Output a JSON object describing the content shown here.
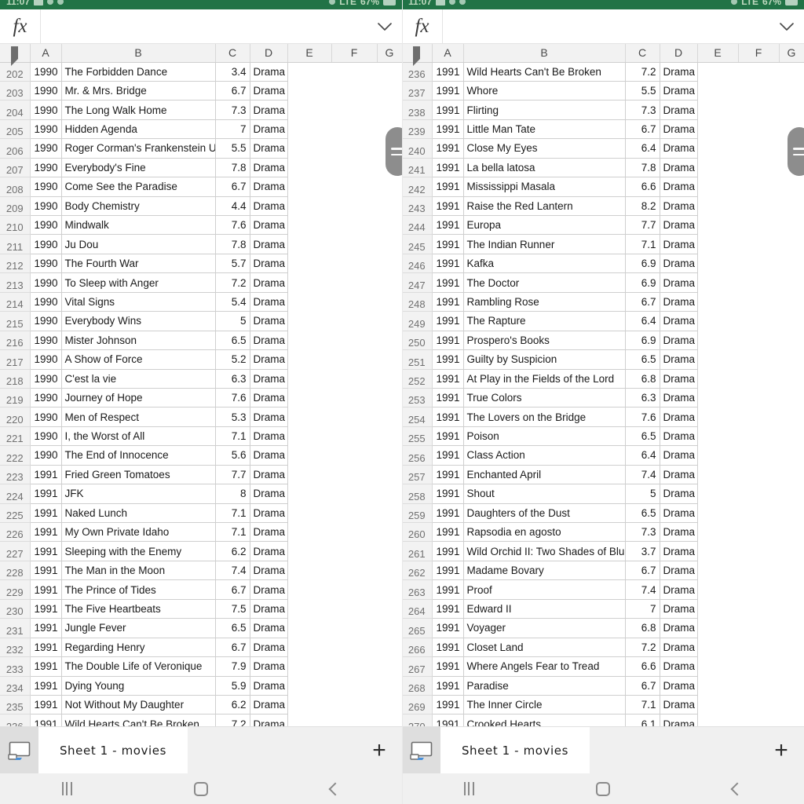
{
  "app": {
    "accent_color": "#217346",
    "status_bar": {
      "time": "11:07",
      "battery": "67%",
      "network": "LTE"
    }
  },
  "formula_bar": {
    "fx_label": "fx",
    "value": "",
    "placeholder": "",
    "chevron": "⌄"
  },
  "columns": {
    "headers": [
      "A",
      "B",
      "C",
      "D",
      "E",
      "F",
      "G"
    ],
    "corner": "select-all"
  },
  "sheet_tab": {
    "label": "Sheet 1 - movies",
    "add_label": "+"
  },
  "nav": {
    "recent": "recents",
    "home": "home",
    "back": "back"
  },
  "panes": [
    {
      "id": "left",
      "rows": [
        {
          "n": "202",
          "year": "1990",
          "title": "The Forbidden Dance",
          "score": "3.4",
          "genre": "Drama"
        },
        {
          "n": "203",
          "year": "1990",
          "title": "Mr. & Mrs. Bridge",
          "score": "6.7",
          "genre": "Drama"
        },
        {
          "n": "204",
          "year": "1990",
          "title": "The Long Walk Home",
          "score": "7.3",
          "genre": "Drama"
        },
        {
          "n": "205",
          "year": "1990",
          "title": "Hidden Agenda",
          "score": "7",
          "genre": "Drama"
        },
        {
          "n": "206",
          "year": "1990",
          "title": "Roger Corman's Frankenstein Unbound",
          "score": "5.5",
          "genre": "Drama"
        },
        {
          "n": "207",
          "year": "1990",
          "title": "Everybody's Fine",
          "score": "7.8",
          "genre": "Drama"
        },
        {
          "n": "208",
          "year": "1990",
          "title": "Come See the Paradise",
          "score": "6.7",
          "genre": "Drama"
        },
        {
          "n": "209",
          "year": "1990",
          "title": "Body Chemistry",
          "score": "4.4",
          "genre": "Drama"
        },
        {
          "n": "210",
          "year": "1990",
          "title": "Mindwalk",
          "score": "7.6",
          "genre": "Drama"
        },
        {
          "n": "211",
          "year": "1990",
          "title": "Ju Dou",
          "score": "7.8",
          "genre": "Drama"
        },
        {
          "n": "212",
          "year": "1990",
          "title": "The Fourth War",
          "score": "5.7",
          "genre": "Drama"
        },
        {
          "n": "213",
          "year": "1990",
          "title": "To Sleep with Anger",
          "score": "7.2",
          "genre": "Drama"
        },
        {
          "n": "214",
          "year": "1990",
          "title": "Vital Signs",
          "score": "5.4",
          "genre": "Drama"
        },
        {
          "n": "215",
          "year": "1990",
          "title": "Everybody Wins",
          "score": "5",
          "genre": "Drama"
        },
        {
          "n": "216",
          "year": "1990",
          "title": "Mister Johnson",
          "score": "6.5",
          "genre": "Drama"
        },
        {
          "n": "217",
          "year": "1990",
          "title": "A Show of Force",
          "score": "5.2",
          "genre": "Drama"
        },
        {
          "n": "218",
          "year": "1990",
          "title": "C'est la vie",
          "score": "6.3",
          "genre": "Drama"
        },
        {
          "n": "219",
          "year": "1990",
          "title": "Journey of Hope",
          "score": "7.6",
          "genre": "Drama"
        },
        {
          "n": "220",
          "year": "1990",
          "title": "Men of Respect",
          "score": "5.3",
          "genre": "Drama"
        },
        {
          "n": "221",
          "year": "1990",
          "title": "I, the Worst of All",
          "score": "7.1",
          "genre": "Drama"
        },
        {
          "n": "222",
          "year": "1990",
          "title": "The End of Innocence",
          "score": "5.6",
          "genre": "Drama"
        },
        {
          "n": "223",
          "year": "1991",
          "title": "Fried Green Tomatoes",
          "score": "7.7",
          "genre": "Drama"
        },
        {
          "n": "224",
          "year": "1991",
          "title": "JFK",
          "score": "8",
          "genre": "Drama"
        },
        {
          "n": "225",
          "year": "1991",
          "title": "Naked Lunch",
          "score": "7.1",
          "genre": "Drama"
        },
        {
          "n": "226",
          "year": "1991",
          "title": "My Own Private Idaho",
          "score": "7.1",
          "genre": "Drama"
        },
        {
          "n": "227",
          "year": "1991",
          "title": "Sleeping with the Enemy",
          "score": "6.2",
          "genre": "Drama"
        },
        {
          "n": "228",
          "year": "1991",
          "title": "The Man in the Moon",
          "score": "7.4",
          "genre": "Drama"
        },
        {
          "n": "229",
          "year": "1991",
          "title": "The Prince of Tides",
          "score": "6.7",
          "genre": "Drama"
        },
        {
          "n": "230",
          "year": "1991",
          "title": "The Five Heartbeats",
          "score": "7.5",
          "genre": "Drama"
        },
        {
          "n": "231",
          "year": "1991",
          "title": "Jungle Fever",
          "score": "6.5",
          "genre": "Drama"
        },
        {
          "n": "232",
          "year": "1991",
          "title": "Regarding Henry",
          "score": "6.7",
          "genre": "Drama"
        },
        {
          "n": "233",
          "year": "1991",
          "title": "The Double Life of Veronique",
          "score": "7.9",
          "genre": "Drama"
        },
        {
          "n": "234",
          "year": "1991",
          "title": "Dying Young",
          "score": "5.9",
          "genre": "Drama"
        },
        {
          "n": "235",
          "year": "1991",
          "title": "Not Without My Daughter",
          "score": "6.2",
          "genre": "Drama"
        },
        {
          "n": "236",
          "year": "1991",
          "title": "Wild Hearts Can't Be Broken",
          "score": "7.2",
          "genre": "Drama"
        }
      ]
    },
    {
      "id": "right",
      "rows": [
        {
          "n": "236",
          "year": "1991",
          "title": "Wild Hearts Can't Be Broken",
          "score": "7.2",
          "genre": "Drama"
        },
        {
          "n": "237",
          "year": "1991",
          "title": "Whore",
          "score": "5.5",
          "genre": "Drama"
        },
        {
          "n": "238",
          "year": "1991",
          "title": "Flirting",
          "score": "7.3",
          "genre": "Drama"
        },
        {
          "n": "239",
          "year": "1991",
          "title": "Little Man Tate",
          "score": "6.7",
          "genre": "Drama"
        },
        {
          "n": "240",
          "year": "1991",
          "title": "Close My Eyes",
          "score": "6.4",
          "genre": "Drama"
        },
        {
          "n": "241",
          "year": "1991",
          "title": "La bella latosa",
          "score": "7.8",
          "genre": "Drama"
        },
        {
          "n": "242",
          "year": "1991",
          "title": "Mississippi Masala",
          "score": "6.6",
          "genre": "Drama"
        },
        {
          "n": "243",
          "year": "1991",
          "title": "Raise the Red Lantern",
          "score": "8.2",
          "genre": "Drama"
        },
        {
          "n": "244",
          "year": "1991",
          "title": "Europa",
          "score": "7.7",
          "genre": "Drama"
        },
        {
          "n": "245",
          "year": "1991",
          "title": "The Indian Runner",
          "score": "7.1",
          "genre": "Drama"
        },
        {
          "n": "246",
          "year": "1991",
          "title": "Kafka",
          "score": "6.9",
          "genre": "Drama"
        },
        {
          "n": "247",
          "year": "1991",
          "title": "The Doctor",
          "score": "6.9",
          "genre": "Drama"
        },
        {
          "n": "248",
          "year": "1991",
          "title": "Rambling Rose",
          "score": "6.7",
          "genre": "Drama"
        },
        {
          "n": "249",
          "year": "1991",
          "title": "The Rapture",
          "score": "6.4",
          "genre": "Drama"
        },
        {
          "n": "250",
          "year": "1991",
          "title": "Prospero's Books",
          "score": "6.9",
          "genre": "Drama"
        },
        {
          "n": "251",
          "year": "1991",
          "title": "Guilty by Suspicion",
          "score": "6.5",
          "genre": "Drama"
        },
        {
          "n": "252",
          "year": "1991",
          "title": "At Play in the Fields of the Lord",
          "score": "6.8",
          "genre": "Drama"
        },
        {
          "n": "253",
          "year": "1991",
          "title": "True Colors",
          "score": "6.3",
          "genre": "Drama"
        },
        {
          "n": "254",
          "year": "1991",
          "title": "The Lovers on the Bridge",
          "score": "7.6",
          "genre": "Drama"
        },
        {
          "n": "255",
          "year": "1991",
          "title": "Poison",
          "score": "6.5",
          "genre": "Drama"
        },
        {
          "n": "256",
          "year": "1991",
          "title": "Class Action",
          "score": "6.4",
          "genre": "Drama"
        },
        {
          "n": "257",
          "year": "1991",
          "title": "Enchanted April",
          "score": "7.4",
          "genre": "Drama"
        },
        {
          "n": "258",
          "year": "1991",
          "title": "Shout",
          "score": "5",
          "genre": "Drama"
        },
        {
          "n": "259",
          "year": "1991",
          "title": "Daughters of the Dust",
          "score": "6.5",
          "genre": "Drama"
        },
        {
          "n": "260",
          "year": "1991",
          "title": "Rapsodia en agosto",
          "score": "7.3",
          "genre": "Drama"
        },
        {
          "n": "261",
          "year": "1991",
          "title": "Wild Orchid II: Two Shades of Blue",
          "score": "3.7",
          "genre": "Drama"
        },
        {
          "n": "262",
          "year": "1991",
          "title": "Madame Bovary",
          "score": "6.7",
          "genre": "Drama"
        },
        {
          "n": "263",
          "year": "1991",
          "title": "Proof",
          "score": "7.4",
          "genre": "Drama"
        },
        {
          "n": "264",
          "year": "1991",
          "title": "Edward II",
          "score": "7",
          "genre": "Drama"
        },
        {
          "n": "265",
          "year": "1991",
          "title": "Voyager",
          "score": "6.8",
          "genre": "Drama"
        },
        {
          "n": "266",
          "year": "1991",
          "title": "Closet Land",
          "score": "7.2",
          "genre": "Drama"
        },
        {
          "n": "267",
          "year": "1991",
          "title": "Where Angels Fear to Tread",
          "score": "6.6",
          "genre": "Drama"
        },
        {
          "n": "268",
          "year": "1991",
          "title": "Paradise",
          "score": "6.7",
          "genre": "Drama"
        },
        {
          "n": "269",
          "year": "1991",
          "title": "The Inner Circle",
          "score": "7.1",
          "genre": "Drama"
        },
        {
          "n": "270",
          "year": "1991",
          "title": "Crooked Hearts",
          "score": "6.1",
          "genre": "Drama"
        }
      ]
    }
  ]
}
